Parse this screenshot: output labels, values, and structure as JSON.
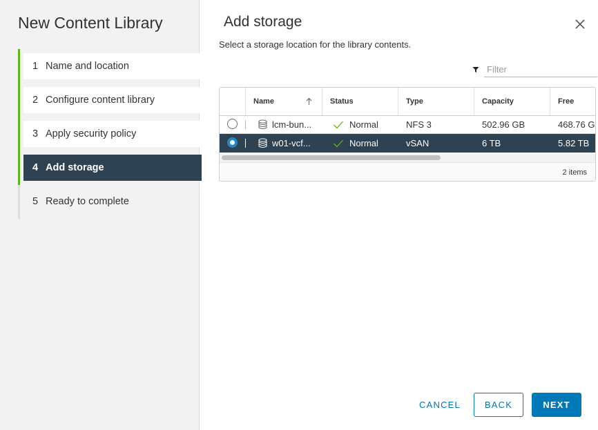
{
  "wizard": {
    "title": "New Content Library",
    "steps": [
      {
        "num": "1",
        "label": "Name and location"
      },
      {
        "num": "2",
        "label": "Configure content library"
      },
      {
        "num": "3",
        "label": "Apply security policy"
      },
      {
        "num": "4",
        "label": "Add storage"
      },
      {
        "num": "5",
        "label": "Ready to complete"
      }
    ],
    "active_step": 4
  },
  "dialog": {
    "title": "Add storage",
    "subtitle": "Select a storage location for the library contents.",
    "close_icon": "close-icon"
  },
  "filter": {
    "placeholder": "Filter",
    "icon": "filter-icon"
  },
  "grid": {
    "columns": [
      "Name",
      "Status",
      "Type",
      "Capacity",
      "Free"
    ],
    "sort_column": "Name",
    "sort_direction": "ascending",
    "rows": [
      {
        "name": "lcm-bun...",
        "status": "Normal",
        "type": "NFS 3",
        "capacity": "502.96 GB",
        "free": "468.76 G",
        "selected": false
      },
      {
        "name": "w01-vcf...",
        "status": "Normal",
        "type": "vSAN",
        "capacity": "6 TB",
        "free": "5.82 TB",
        "selected": true
      }
    ],
    "footer": "2 items"
  },
  "buttons": {
    "cancel": "CANCEL",
    "back": "BACK",
    "next": "NEXT"
  },
  "colors": {
    "accent": "#0079b8",
    "selected_row": "#2f4252",
    "progress_green": "#5eb715",
    "status_check": "#5eb715"
  }
}
